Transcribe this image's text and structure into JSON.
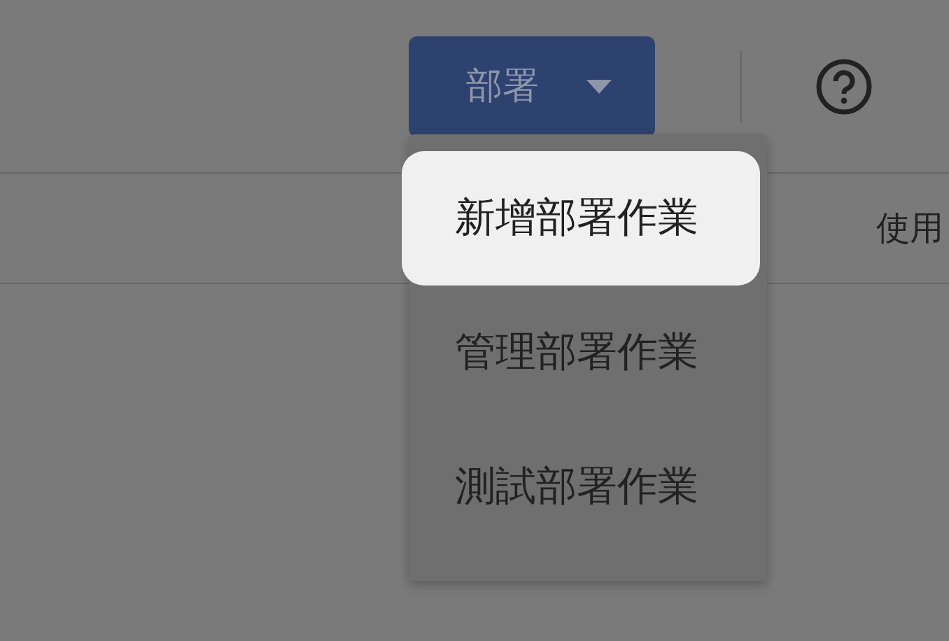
{
  "toolbar": {
    "deploy_button": {
      "label": "部署"
    }
  },
  "table": {
    "column_header": "使用"
  },
  "menu": {
    "items": [
      {
        "label": "新增部署作業",
        "selected": true
      },
      {
        "label": "管理部署作業",
        "selected": false
      },
      {
        "label": "測試部署作業",
        "selected": false
      }
    ]
  }
}
